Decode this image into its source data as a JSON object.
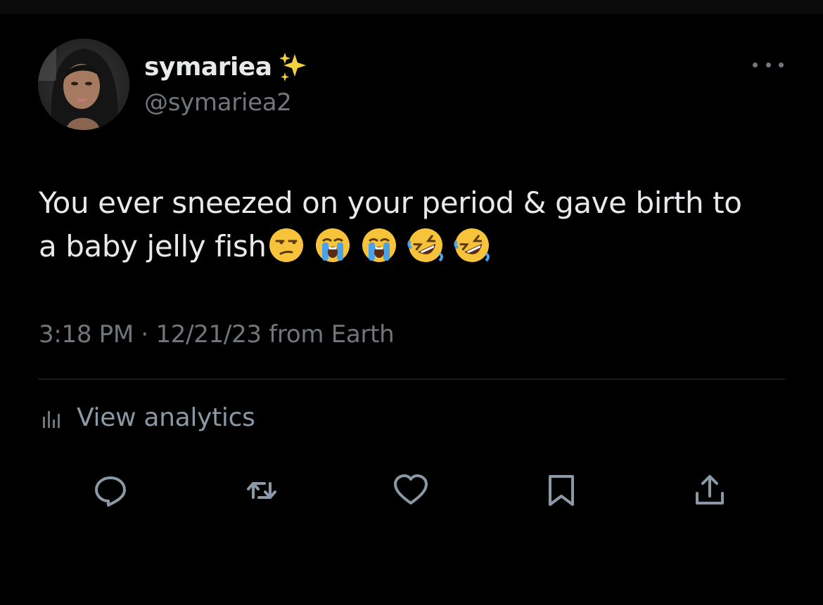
{
  "tweet": {
    "author": {
      "display_name": "symariea",
      "name_emoji": "sparkles-icon",
      "handle": "@symariea2",
      "avatar": "avatar"
    },
    "text": {
      "line1": "You ever sneezed on your period & gave birth to",
      "line2": "a baby jelly fish",
      "emojis": [
        "unamused-face-icon",
        "loudly-crying-face-icon",
        "loudly-crying-face-icon",
        "rolling-on-floor-laughing-icon",
        "rolling-on-floor-laughing-icon"
      ]
    },
    "meta": {
      "time": "3:18 PM",
      "separator": " · ",
      "date": "12/21/23",
      "source": " from Earth"
    },
    "analytics": {
      "label": "View analytics",
      "icon": "analytics-icon"
    },
    "actions": [
      {
        "name": "reply",
        "icon": "reply-icon"
      },
      {
        "name": "retweet",
        "icon": "retweet-icon"
      },
      {
        "name": "like",
        "icon": "heart-icon"
      },
      {
        "name": "bookmark",
        "icon": "bookmark-icon"
      },
      {
        "name": "share",
        "icon": "share-icon"
      }
    ],
    "more_icon": "more-icon"
  },
  "colors": {
    "background": "#000000",
    "primary_text": "#e7e9ea",
    "secondary_text": "#71767b",
    "divider": "#2f3336",
    "icon": "#8b98a5"
  }
}
